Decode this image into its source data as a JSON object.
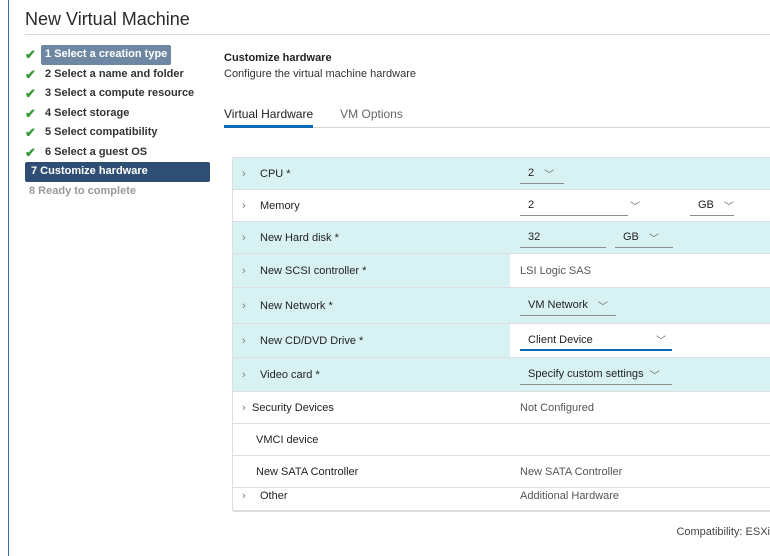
{
  "window": {
    "title": "New Virtual Machine"
  },
  "steps": [
    {
      "label": "1 Select a creation type",
      "done": true,
      "selected": true
    },
    {
      "label": "2 Select a name and folder",
      "done": true
    },
    {
      "label": "3 Select a compute resource",
      "done": true
    },
    {
      "label": "4 Select storage",
      "done": true
    },
    {
      "label": "5 Select compatibility",
      "done": true
    },
    {
      "label": "6 Select a guest OS",
      "done": true
    },
    {
      "label": "7 Customize hardware",
      "current": true
    },
    {
      "label": "8 Ready to complete",
      "disabled": true
    }
  ],
  "header": {
    "title": "Customize hardware",
    "subtitle": "Configure the virtual machine hardware"
  },
  "tabs": [
    {
      "label": "Virtual Hardware",
      "active": true
    },
    {
      "label": "VM Options"
    }
  ],
  "hardware": {
    "cpu": {
      "label": "CPU *",
      "value": "2"
    },
    "memory": {
      "label": "Memory",
      "value": "2",
      "unit": "GB"
    },
    "hard_disk": {
      "label": "New Hard disk *",
      "value": "32",
      "unit": "GB"
    },
    "scsi": {
      "label": "New SCSI controller *",
      "value": "LSI Logic SAS"
    },
    "network": {
      "label": "New Network *",
      "value": "VM Network"
    },
    "cddvd": {
      "label": "New CD/DVD Drive *",
      "value": "Client Device"
    },
    "video": {
      "label": "Video card *",
      "value": "Specify custom settings"
    },
    "security": {
      "label": "Security Devices",
      "value": "Not Configured"
    },
    "vmci": {
      "label": "VMCI device",
      "value": ""
    },
    "sata": {
      "label": "New SATA Controller",
      "value": "New SATA Controller"
    },
    "other": {
      "label": "Other",
      "value": "Additional Hardware"
    }
  },
  "footer": {
    "compatibility": "Compatibility: ESXi"
  },
  "icons": {
    "check": "check-icon",
    "chevron_right": "chevron-right-icon",
    "chevron_down": "chevron-down-icon"
  },
  "colors": {
    "accent": "#0a6ab7",
    "current_step": "#2e4f73",
    "selected_step": "#6e88a3",
    "check": "#3a9a3a",
    "highlight_row": "#d8f2f3"
  }
}
